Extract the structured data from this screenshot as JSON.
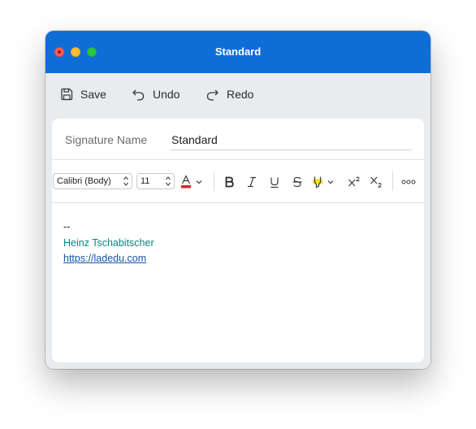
{
  "window": {
    "title": "Standard"
  },
  "toolbar": {
    "save": "Save",
    "undo": "Undo",
    "redo": "Redo"
  },
  "signature": {
    "label": "Signature Name",
    "value": "Standard"
  },
  "format": {
    "font": "Calibri (Body)",
    "size": "11"
  },
  "body": {
    "dash": "--",
    "name": "Heinz Tschabitscher",
    "link": "https://ladedu.com"
  },
  "colors": {
    "titlebar": "#0f6dd8",
    "name_text": "#0a8585",
    "link_text": "#1556a5",
    "font_color_bar": "#d7262c",
    "highlight": "#f6e316"
  }
}
